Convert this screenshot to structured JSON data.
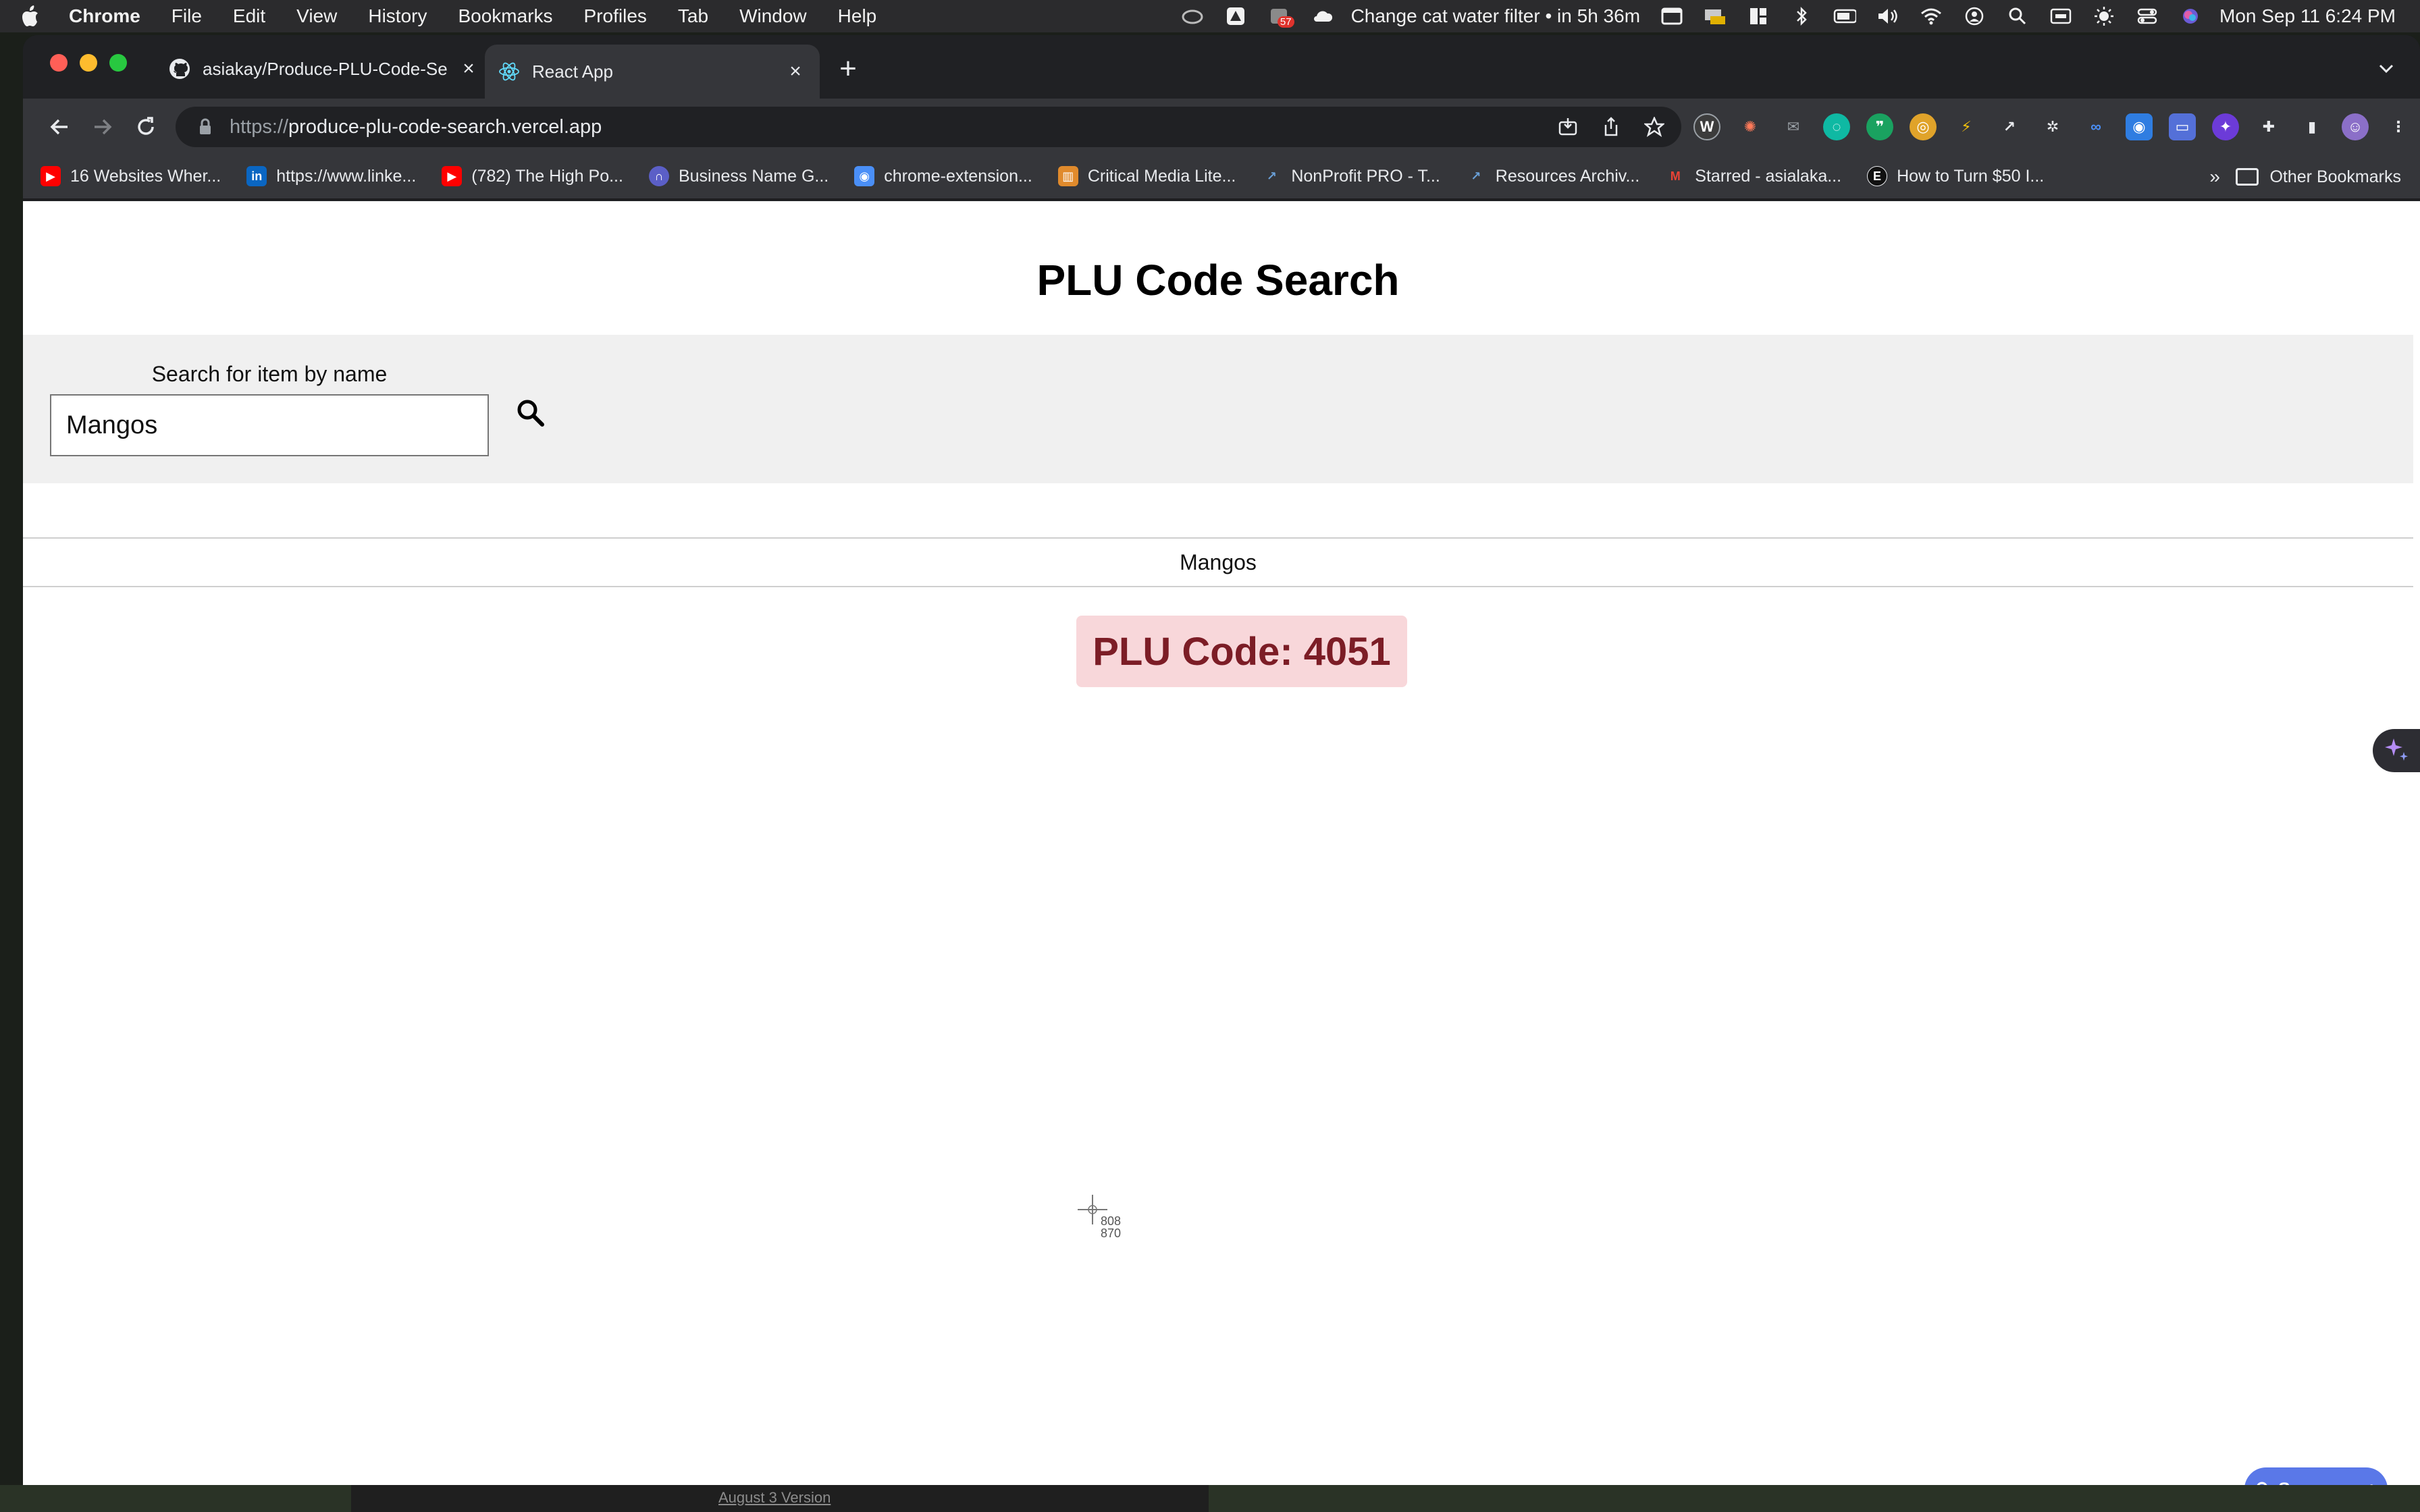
{
  "menubar": {
    "app_name": "Chrome",
    "menus": [
      "File",
      "Edit",
      "View",
      "History",
      "Bookmarks",
      "Profiles",
      "Tab",
      "Window",
      "Help"
    ],
    "calendar_reminder": "Change cat water filter • in 5h 36m",
    "badge_count": "57",
    "datetime": "Mon Sep 11  6:24 PM"
  },
  "tabs": [
    {
      "title": "asiakay/Produce-PLU-Code-Se",
      "favicon": "github-icon"
    },
    {
      "title": "React App",
      "favicon": "react-icon",
      "active": true
    }
  ],
  "omnibox": {
    "scheme": "https://",
    "host": "produce-plu-code-search.vercel.app"
  },
  "bookmarks": [
    {
      "label": "16 Websites Wher...",
      "icon": "youtube-icon",
      "color": "#ff0000"
    },
    {
      "label": "https://www.linke...",
      "icon": "linkedin-icon",
      "color": "#0a66c2"
    },
    {
      "label": "(782) The High Po...",
      "icon": "youtube-icon",
      "color": "#ff0000"
    },
    {
      "label": "Business Name G...",
      "icon": "namelix-icon",
      "color": "#5b5fc7"
    },
    {
      "label": "chrome-extension...",
      "icon": "extension-icon",
      "color": "#4a8ff7"
    },
    {
      "label": "Critical Media Lite...",
      "icon": "doc-icon",
      "color": "#e08a2c"
    },
    {
      "label": "NonProfit PRO - T...",
      "icon": "site-icon",
      "color": "#3a6ea5"
    },
    {
      "label": "Resources Archiv...",
      "icon": "site-icon",
      "color": "#3a6ea5"
    },
    {
      "label": "Starred - asialaka...",
      "icon": "gmail-icon",
      "color": "#ea4335"
    },
    {
      "label": "How to Turn $50 I...",
      "icon": "e-icon",
      "color": "#111111"
    }
  ],
  "bookmarks_more": "»",
  "other_bookmarks": "Other Bookmarks",
  "page": {
    "title": "PLU Code Search",
    "search_label": "Search for item by name",
    "search_value": "Mangos",
    "result_name": "Mangos",
    "plu_text": "PLU Code: 4051"
  },
  "cursor_readout": {
    "x": "808",
    "y": "870"
  },
  "summary_button": "Summary +",
  "desktop_link": "August 3 Version",
  "colors": {
    "plu_badge_bg": "#f8d7da",
    "plu_badge_text": "#7c1d26",
    "search_band": "#f0f0f0",
    "summary_bg": "#5a78e8"
  }
}
